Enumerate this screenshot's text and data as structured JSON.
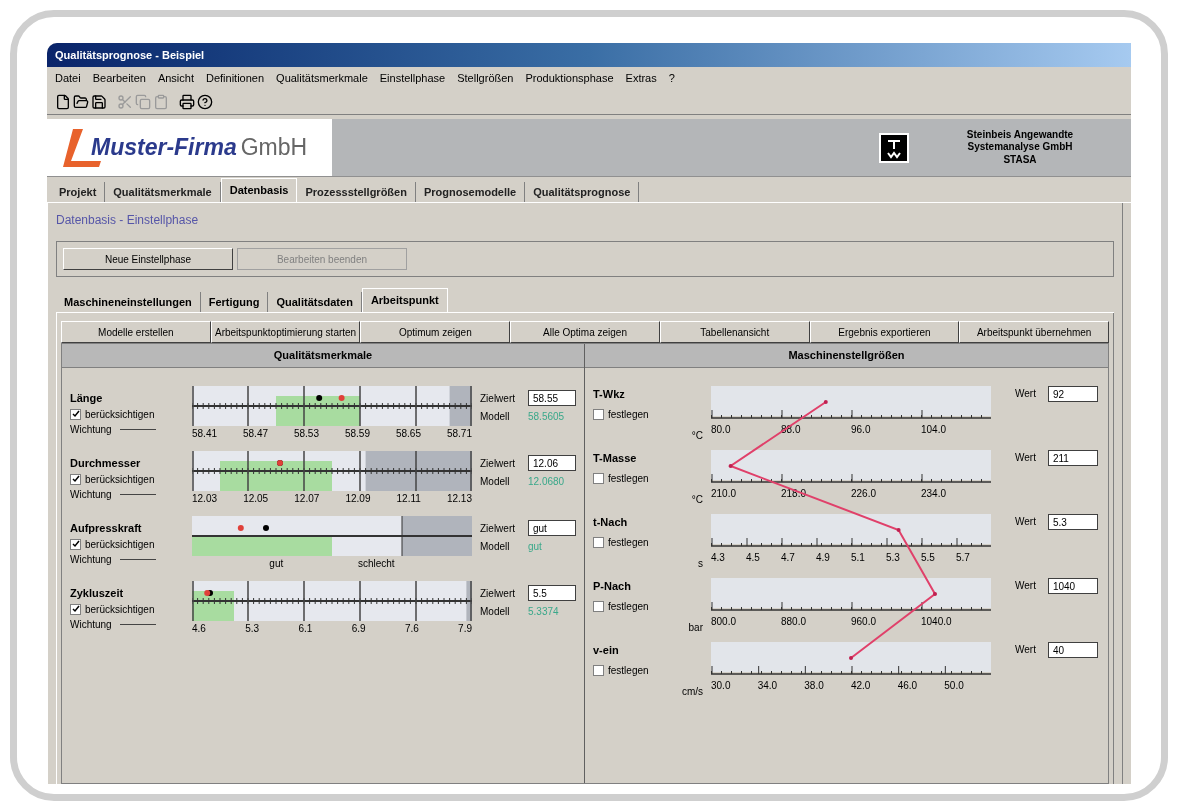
{
  "window": {
    "title": "Qualitätsprognose - Beispiel"
  },
  "menu": [
    "Datei",
    "Bearbeiten",
    "Ansicht",
    "Definitionen",
    "Qualitätsmerkmale",
    "Einstellphase",
    "Stellgrößen",
    "Produktionsphase",
    "Extras",
    "?"
  ],
  "logo": {
    "name": "Muster-Firma",
    "suffix": "GmbH"
  },
  "vendor": {
    "lines": [
      "Steinbeis Angewandte",
      "Systemanalyse GmbH",
      "STASA"
    ]
  },
  "tabs": [
    {
      "label": "Projekt",
      "selected": false
    },
    {
      "label": "Qualitätsmerkmale",
      "selected": false
    },
    {
      "label": "Datenbasis",
      "selected": true
    },
    {
      "label": "Prozessstellgrößen",
      "selected": false
    },
    {
      "label": "Prognosemodelle",
      "selected": false
    },
    {
      "label": "Qualitätsprognose",
      "selected": false
    }
  ],
  "section_title": "Datenbasis - Einstellphase",
  "phase_buttons": [
    {
      "label": "Neue Einstellphase",
      "disabled": false
    },
    {
      "label": "Bearbeiten beenden",
      "disabled": true
    }
  ],
  "subtabs": [
    {
      "label": "Maschineneinstellungen",
      "selected": false
    },
    {
      "label": "Fertigung",
      "selected": false
    },
    {
      "label": "Qualitätsdaten",
      "selected": false
    },
    {
      "label": "Arbeitspunkt",
      "selected": true
    }
  ],
  "actions": [
    "Modelle erstellen",
    "Arbeitspunktoptimierung starten",
    "Optimum zeigen",
    "Alle Optima zeigen",
    "Tabellenansicht",
    "Ergebnis exportieren",
    "Arbeitspunkt übernehmen"
  ],
  "quality": {
    "title": "Qualitätsmerkmale",
    "rows": [
      {
        "name": "Länge",
        "kind": "numeric",
        "check_label": "berücksichtigen",
        "checked": true,
        "weight_label": "Wichtung",
        "ticks": [
          "58.41",
          "58.47",
          "58.53",
          "58.59",
          "58.65",
          "58.71"
        ],
        "target": {
          "level": 0.44
        },
        "model": {
          "level": 0.52
        },
        "target_label": "Zielwert",
        "target_value": "58.55",
        "model_label": "Modell",
        "model_value": "58.5605"
      },
      {
        "name": "Durchmesser",
        "kind": "numeric",
        "check_label": "berücksichtigen",
        "checked": true,
        "weight_label": "Wichtung",
        "ticks": [
          "12.03",
          "12.05",
          "12.07",
          "12.09",
          "12.11",
          "12.13"
        ],
        "target": {
          "level": 0.3
        },
        "model": {
          "level": 0.3
        },
        "target_label": "Zielwert",
        "target_value": "12.06",
        "model_label": "Modell",
        "model_value": "12.0680"
      },
      {
        "name": "Aufpresskraft",
        "kind": "category",
        "check_label": "berücksichtigen",
        "checked": true,
        "weight_label": "Wichtung",
        "ticks": [
          "gut",
          "schlecht"
        ],
        "target": {
          "level": 0.25
        },
        "model": {
          "level": 0.16
        },
        "target_label": "Zielwert",
        "target_value": "gut",
        "model_label": "Modell",
        "model_value": "gut"
      },
      {
        "name": "Zykluszeit",
        "kind": "numeric",
        "check_label": "berücksichtigen",
        "checked": true,
        "weight_label": "Wichtung",
        "ticks": [
          "4.6",
          "5.3",
          "6.1",
          "6.9",
          "7.6",
          "7.9"
        ],
        "target": {
          "level": 0.05
        },
        "model": {
          "level": 0.04
        },
        "target_label": "Zielwert",
        "target_value": "5.5",
        "model_label": "Modell",
        "model_value": "5.3374"
      }
    ]
  },
  "machine": {
    "title": "Maschinenstellgrößen",
    "rows": [
      {
        "name": "T-Wkz",
        "fix_label": "festlegen",
        "fixed": false,
        "unit": "°C",
        "ticks": [
          "80.0",
          "88.0",
          "96.0",
          "104.0"
        ],
        "value_label": "Wert",
        "value": "92"
      },
      {
        "name": "T-Masse",
        "fix_label": "festlegen",
        "fixed": false,
        "unit": "°C",
        "ticks": [
          "210.0",
          "218.0",
          "226.0",
          "234.0"
        ],
        "value_label": "Wert",
        "value": "211"
      },
      {
        "name": "t-Nach",
        "fix_label": "festlegen",
        "fixed": false,
        "unit": "s",
        "ticks": [
          "4.3",
          "4.5",
          "4.7",
          "4.9",
          "5.1",
          "5.3",
          "5.5",
          "5.7"
        ],
        "value_label": "Wert",
        "value": "5.3"
      },
      {
        "name": "P-Nach",
        "fix_label": "festlegen",
        "fixed": false,
        "unit": "bar",
        "ticks": [
          "800.0",
          "880.0",
          "960.0",
          "1040.0"
        ],
        "value_label": "Wert",
        "value": "1040"
      },
      {
        "name": "v-ein",
        "fix_label": "festlegen",
        "fixed": false,
        "unit": "cm/s",
        "ticks": [
          "30.0",
          "34.0",
          "38.0",
          "42.0",
          "46.0",
          "50.0"
        ],
        "value_label": "Wert",
        "value": "40"
      }
    ]
  }
}
